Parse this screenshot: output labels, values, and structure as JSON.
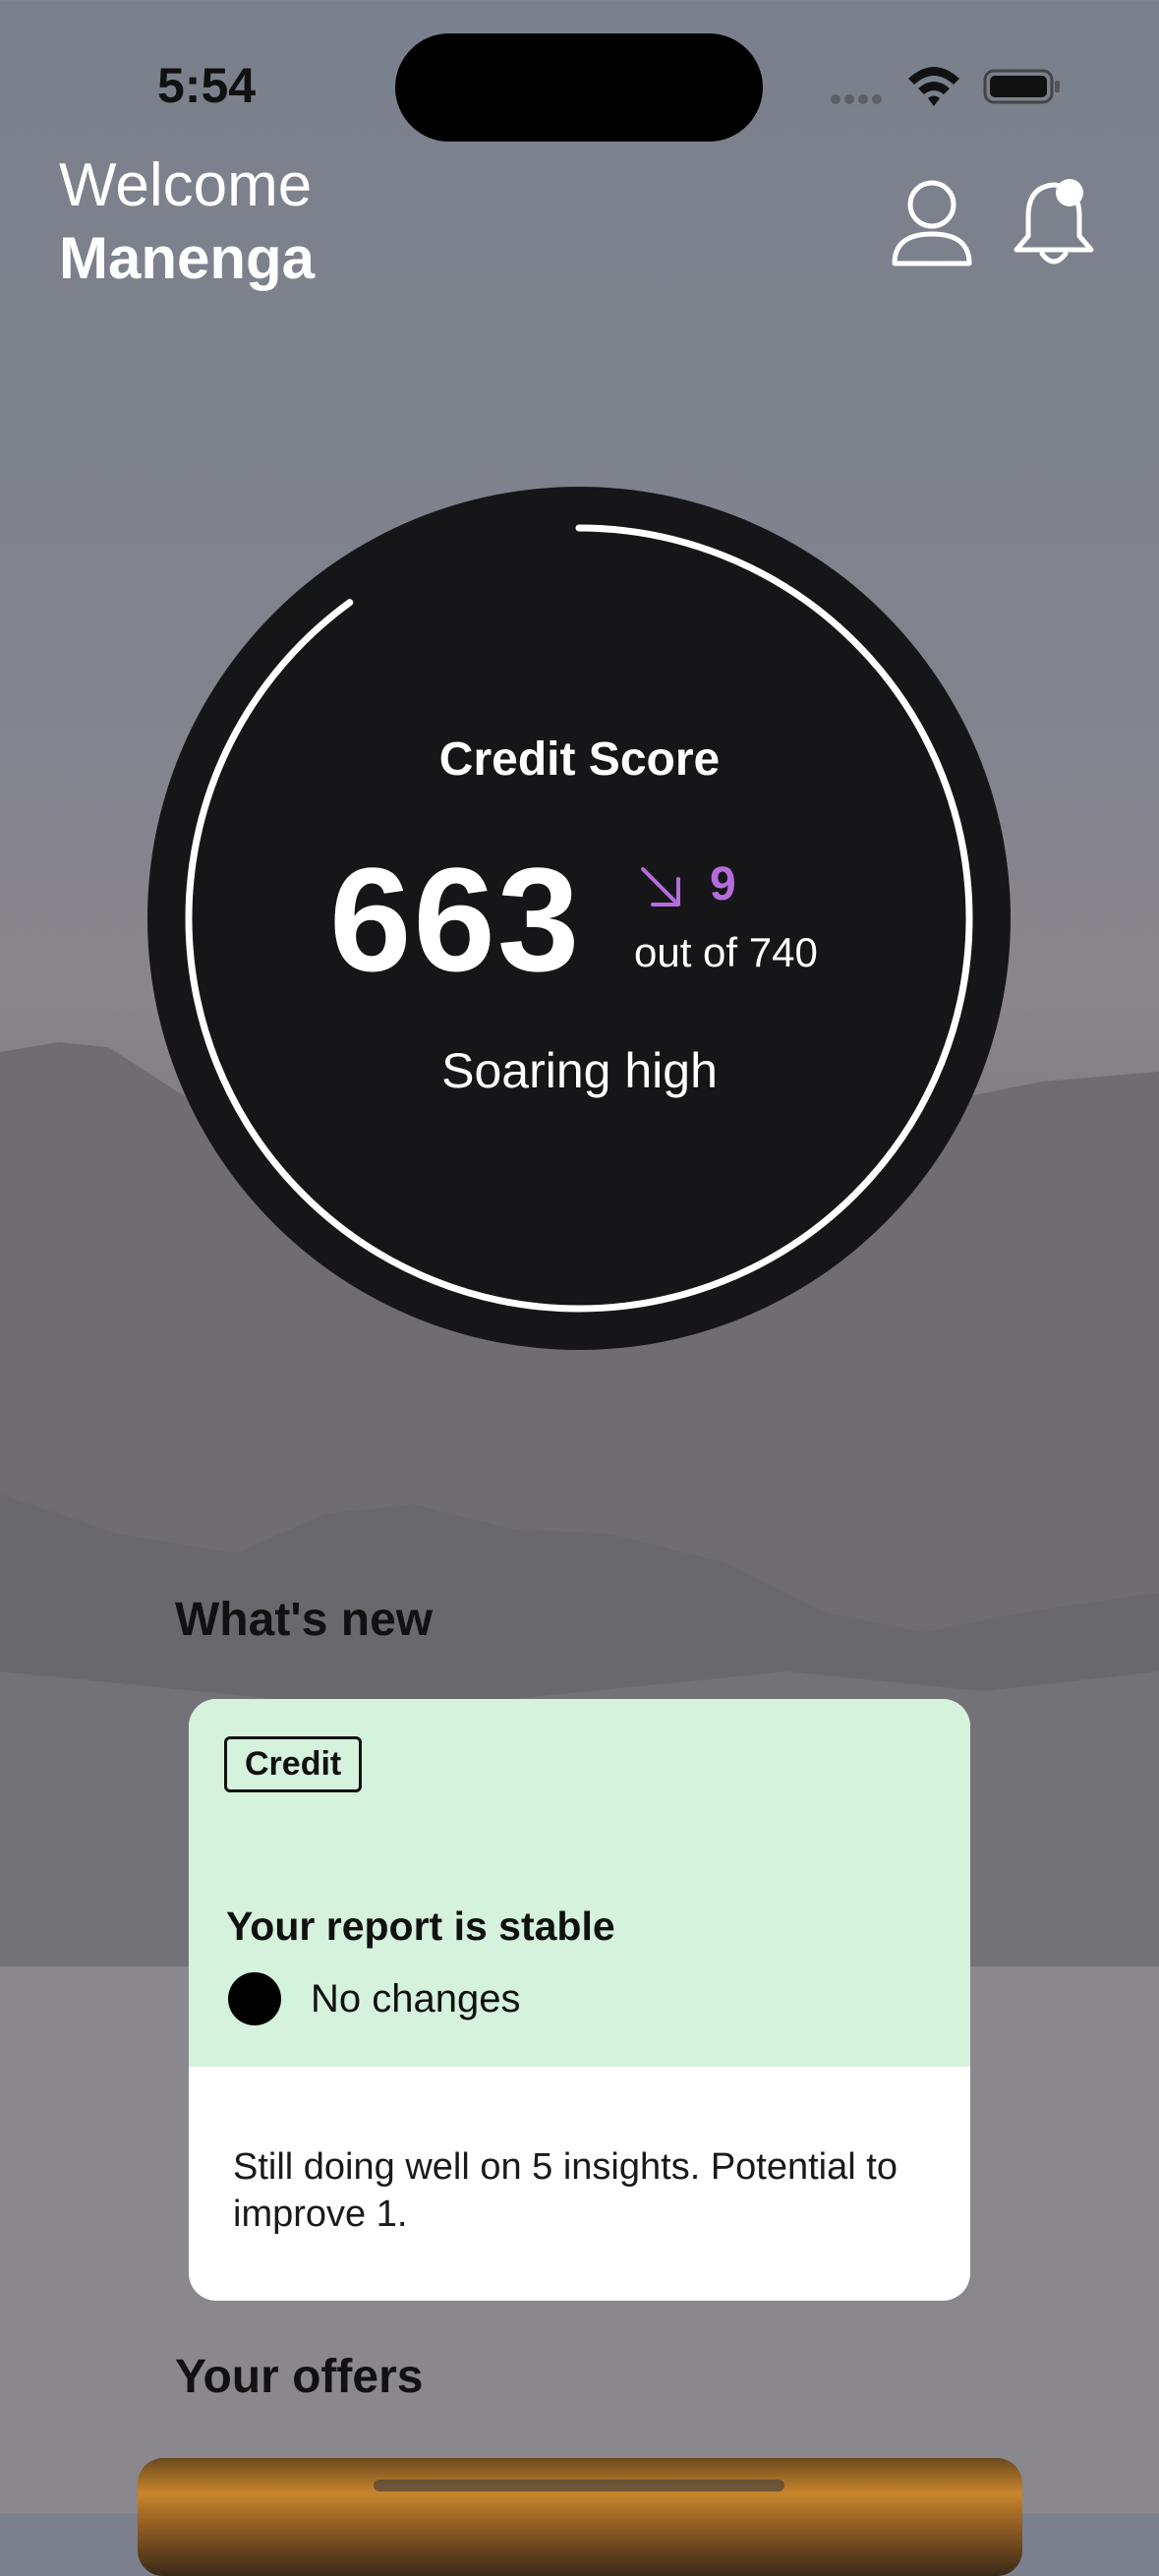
{
  "status_bar": {
    "time": "5:54"
  },
  "header": {
    "greeting": "Welcome",
    "user_name": "Manenga"
  },
  "score": {
    "title": "Credit Score",
    "value": "663",
    "change": "9",
    "change_direction": "down",
    "max_label": "out of 740",
    "rating": "Soaring high",
    "fill_fraction": 0.9
  },
  "whats_new": {
    "title": "What's new",
    "card": {
      "tag": "Credit",
      "headline": "Your report is stable",
      "status": "No changes",
      "body": "Still doing well on 5 insights. Potential to improve 1."
    }
  },
  "offers": {
    "title": "Your offers"
  },
  "colors": {
    "trend": "#b56cdb",
    "card_top": "#d5f2dc",
    "score_bg": "#161618"
  },
  "icons": [
    "wifi-icon",
    "battery-icon",
    "profile-icon",
    "bell-icon",
    "trend-down-icon"
  ]
}
